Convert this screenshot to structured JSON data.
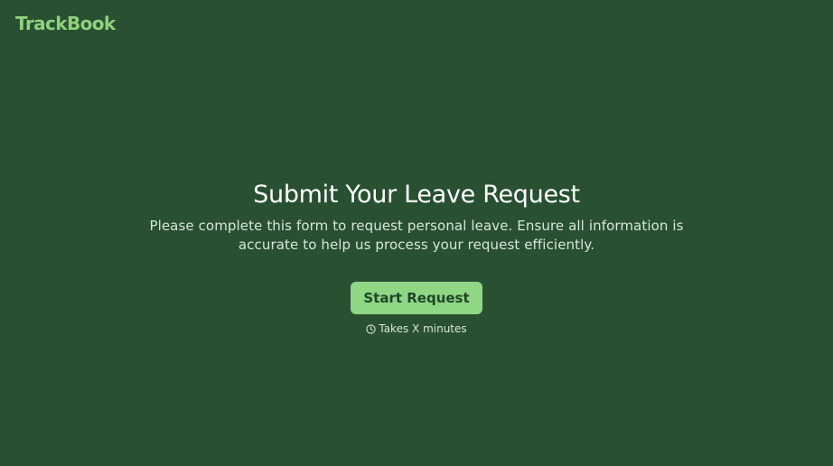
{
  "brand": {
    "name": "TrackBook",
    "color": "#8fd17e"
  },
  "hero": {
    "title": "Submit Your Leave Request",
    "description": "Please complete this form to request personal leave. Ensure all information is accurate to help us process your request efficiently.",
    "cta_label": "Start Request",
    "duration_icon": "clock-icon",
    "duration_text": "Takes X minutes"
  },
  "colors": {
    "background": "#285031",
    "button": "#8fd685",
    "button_text": "#1f4526"
  }
}
